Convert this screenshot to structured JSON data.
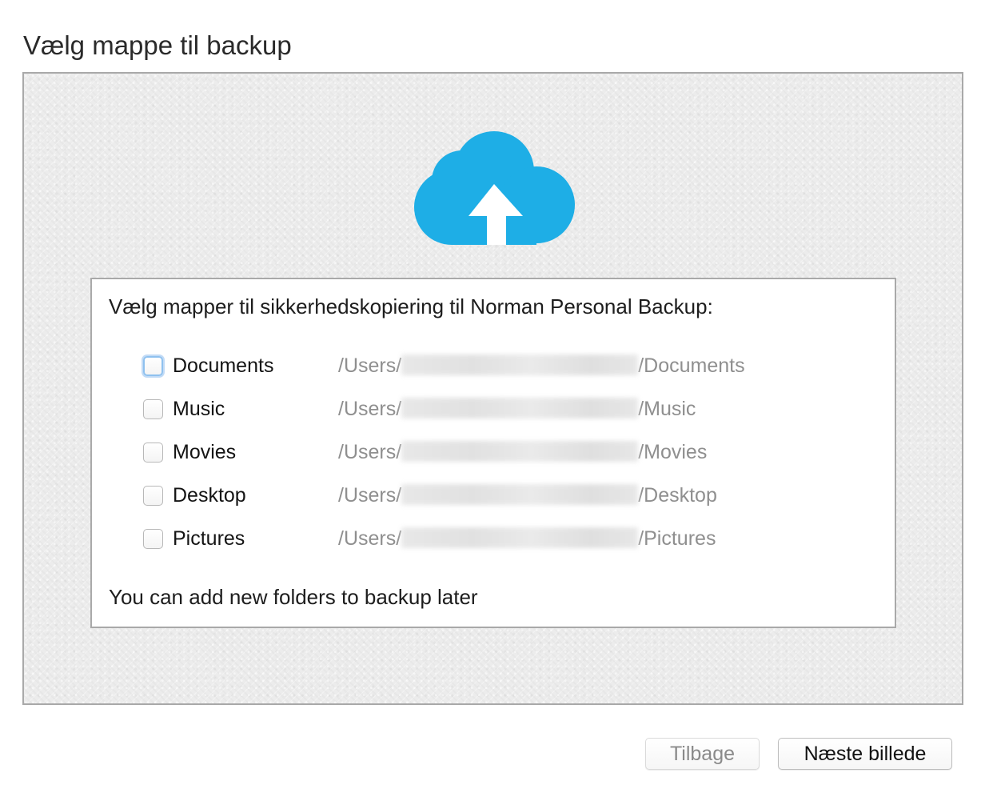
{
  "window": {
    "title": "Vælg mappe til backup"
  },
  "panel": {
    "icon": "cloud-upload-icon",
    "accent_color": "#1eaee6",
    "heading": "Vælg mapper til sikkerhedskopiering til Norman Personal Backup:",
    "folders": [
      {
        "label": "Documents",
        "path_prefix": "/Users/",
        "path_suffix": "/Documents",
        "checked": false
      },
      {
        "label": "Music",
        "path_prefix": "/Users/",
        "path_suffix": "/Music",
        "checked": false
      },
      {
        "label": "Movies",
        "path_prefix": "/Users/",
        "path_suffix": "/Movies",
        "checked": false
      },
      {
        "label": "Desktop",
        "path_prefix": "/Users/",
        "path_suffix": "/Desktop",
        "checked": false
      },
      {
        "label": "Pictures",
        "path_prefix": "/Users/",
        "path_suffix": "/Pictures",
        "checked": false
      }
    ],
    "footnote": "You can add new folders to backup later"
  },
  "buttons": {
    "back_label": "Tilbage",
    "next_label": "Næste billede"
  }
}
